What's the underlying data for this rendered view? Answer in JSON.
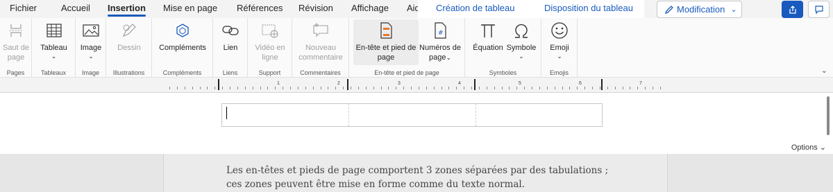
{
  "tabs": [
    {
      "label": "Fichier",
      "active": false
    },
    {
      "label": "Accueil",
      "active": false
    },
    {
      "label": "Insertion",
      "active": true
    },
    {
      "label": "Mise en page",
      "active": false
    },
    {
      "label": "Références",
      "active": false
    },
    {
      "label": "Révision",
      "active": false
    },
    {
      "label": "Affichage",
      "active": false
    },
    {
      "label": "Aide",
      "active": false
    }
  ],
  "context_tabs": [
    "Création de tableau",
    "Disposition du tableau"
  ],
  "editing_mode": {
    "label": "Modification",
    "icon": "pencil-icon"
  },
  "top_right": {
    "share_icon": "share-icon",
    "comment_icon": "comment-icon"
  },
  "ribbon": {
    "groups": [
      {
        "label": "Pages",
        "commands": [
          {
            "label": "Saut de\npage",
            "icon": "page-break-icon",
            "disabled": true
          }
        ]
      },
      {
        "label": "Tableaux",
        "commands": [
          {
            "label": "Tableau",
            "icon": "table-icon",
            "caret": "⌄"
          }
        ]
      },
      {
        "label": "Image",
        "commands": [
          {
            "label": "Image",
            "icon": "picture-icon",
            "caret": "⌄"
          }
        ]
      },
      {
        "label": "Illustrations",
        "commands": [
          {
            "label": "Dessin",
            "icon": "drawing-icon",
            "disabled": true
          }
        ]
      },
      {
        "label": "Compléments",
        "commands": [
          {
            "label": "Compléments",
            "icon": "addins-icon"
          }
        ]
      },
      {
        "label": "Liens",
        "commands": [
          {
            "label": "Lien",
            "icon": "link-icon"
          }
        ]
      },
      {
        "label": "Support",
        "commands": [
          {
            "label": "Vidéo en\nligne",
            "icon": "online-video-icon",
            "disabled": true
          }
        ]
      },
      {
        "label": "Commentaires",
        "commands": [
          {
            "label": "Nouveau\ncommentaire",
            "icon": "new-comment-icon",
            "disabled": true
          }
        ]
      },
      {
        "label": "En-tête et pied de page",
        "commands": [
          {
            "label": "En-tête et pied de\npage",
            "icon": "header-footer-icon",
            "highlighted": true
          },
          {
            "label": "Numéros de\npage",
            "icon": "page-number-icon",
            "caret": "⌄"
          }
        ]
      },
      {
        "label": "Symboles",
        "commands": [
          {
            "label": "Équation",
            "icon": "pi-equation-icon"
          },
          {
            "label": "Symbole",
            "icon": "omega-symbol-icon",
            "caret": "⌄"
          }
        ]
      },
      {
        "label": "Emojis",
        "commands": [
          {
            "label": "Emoji",
            "icon": "emoji-icon",
            "caret": "⌄"
          }
        ]
      }
    ],
    "collapse_icon": "chevron-down-icon"
  },
  "ruler": {
    "numbers": [
      "1",
      "2",
      "3",
      "4",
      "5",
      "6",
      "7"
    ]
  },
  "document": {
    "options_label": "Options ⌄"
  },
  "hint": {
    "text": "Les en-têtes et pieds de page comportent 3 zones séparées par des tabulations ; ces zones peuvent être mise en forme comme du texte normal."
  },
  "colors": {
    "accent": "#185abd",
    "ribbon_bg": "#fafafa",
    "doc_bg": "#ffffff",
    "hint_bg": "#ebebeb"
  }
}
